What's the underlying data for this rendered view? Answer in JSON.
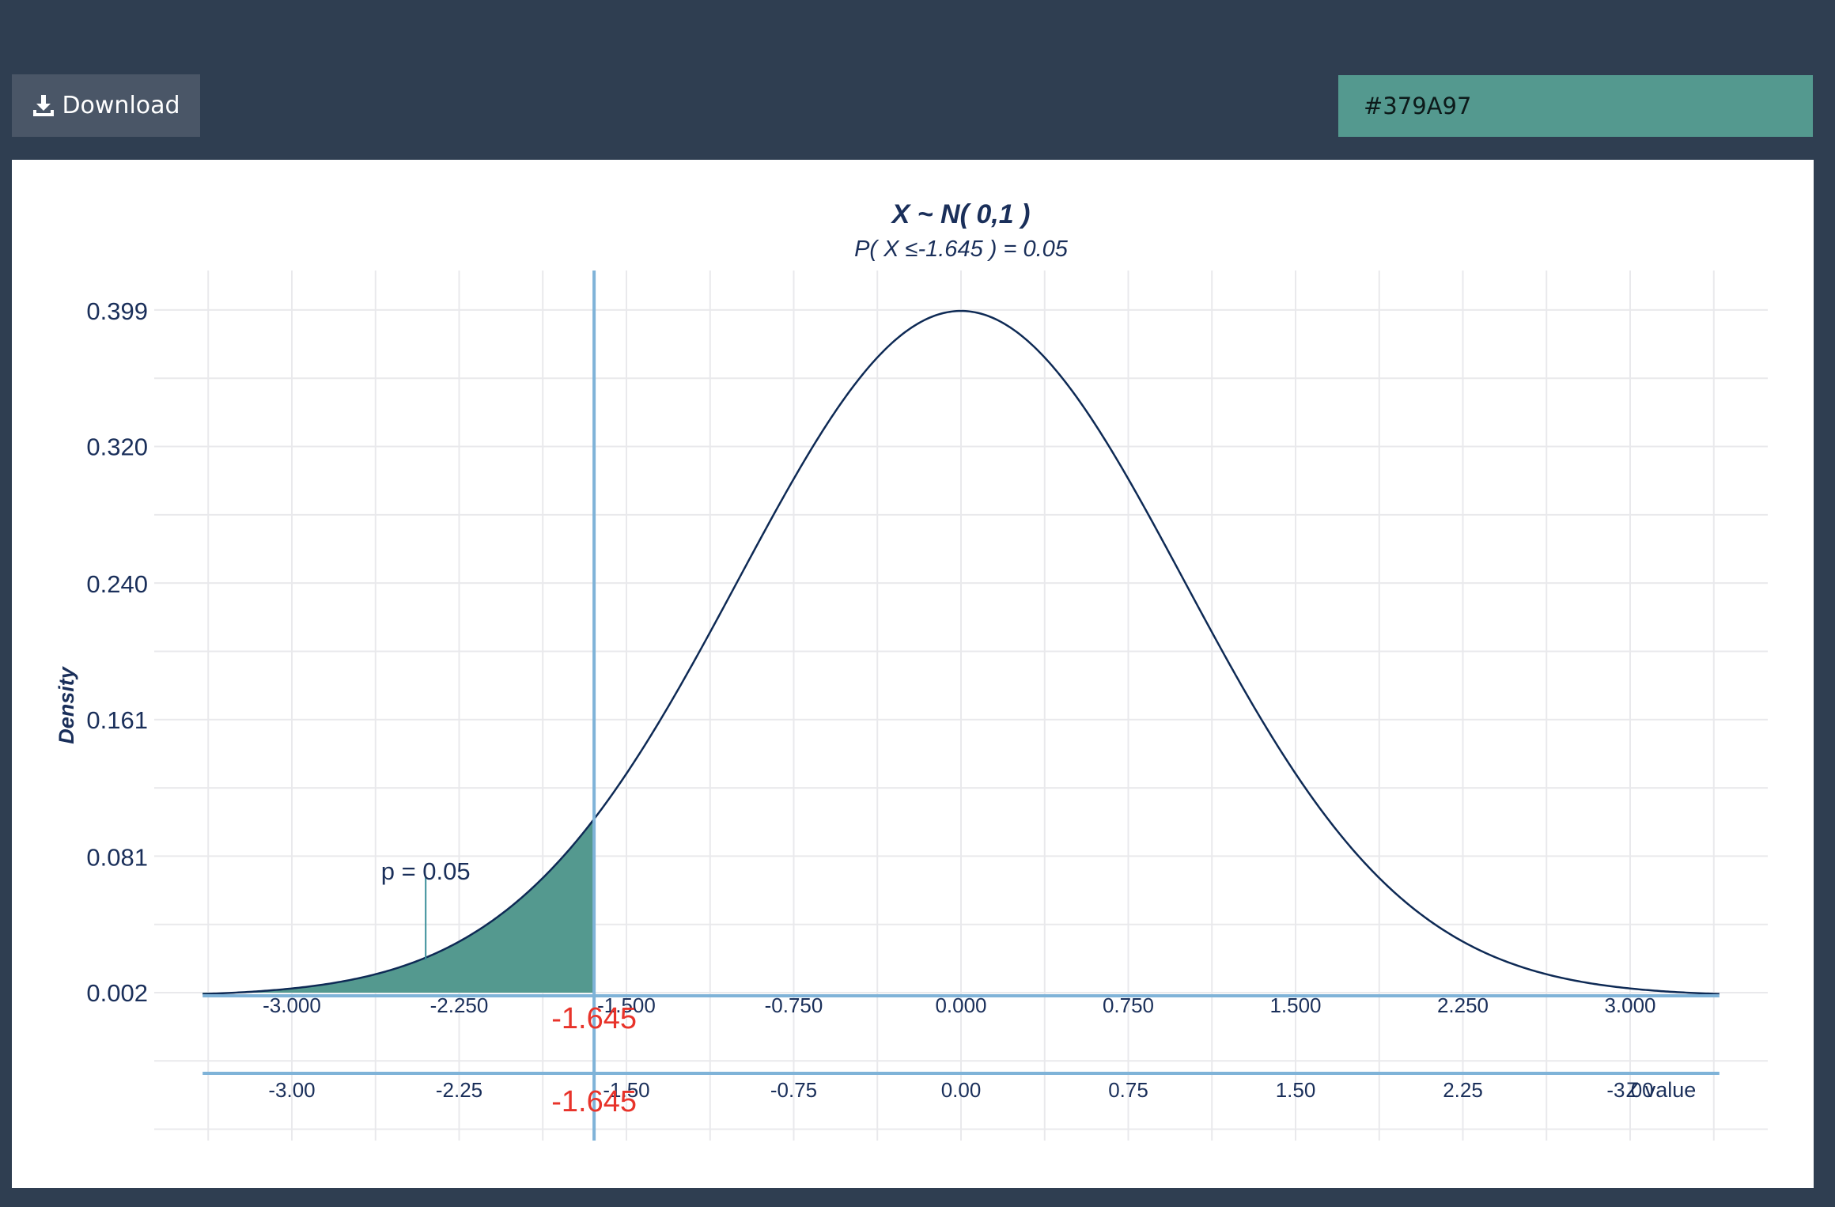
{
  "toolbar": {
    "download_label": "Download",
    "download_icon": "download-icon",
    "color_value": "#379A97"
  },
  "colors": {
    "page_bg": "#2f3e51",
    "fill": "#54998f",
    "curve": "#0e2a55",
    "axis_line": "#7fb3d8",
    "critical": "#e8332a",
    "text": "#1a2f5a"
  },
  "chart_data": {
    "type": "area",
    "title": "X ~ N( 0,1 )",
    "subtitle": "P( X ≤-1.645 ) = 0.05",
    "ylabel": "Density",
    "xlabel": "Z value",
    "distribution": "normal",
    "mean": 0,
    "sd": 1,
    "xlim": [
      -3.4,
      3.4
    ],
    "ylim": [
      -0.066,
      0.423
    ],
    "grid": true,
    "critical_value": -1.645,
    "critical_label": "-1.645",
    "shaded_region": "x <= -1.645",
    "p_label": "p = 0.05",
    "p_label_x": -2.4,
    "y_ticks": [
      0.399,
      0.32,
      0.24,
      0.161,
      0.081,
      0.002
    ],
    "y_tick_labels": [
      "0.399",
      "0.320",
      "0.240",
      "0.161",
      "0.081",
      "0.002"
    ],
    "x_ticks_top": [
      -3.0,
      -2.25,
      -1.5,
      -0.75,
      0.0,
      0.75,
      1.5,
      2.25,
      3.0
    ],
    "x_tick_labels_top": [
      "-3.000",
      "-2.250",
      "-1.500",
      "-0.750",
      "0.000",
      "0.750",
      "1.500",
      "2.250",
      "3.000"
    ],
    "x_ticks_bottom": [
      -3.0,
      -2.25,
      -1.5,
      -0.75,
      0.0,
      0.75,
      1.5,
      2.25,
      3.0
    ],
    "x_tick_labels_bottom": [
      "-3.00",
      "-2.25",
      "-1.50",
      "-0.75",
      "0.00",
      "0.75",
      "1.50",
      "2.25",
      "-3.00"
    ]
  }
}
